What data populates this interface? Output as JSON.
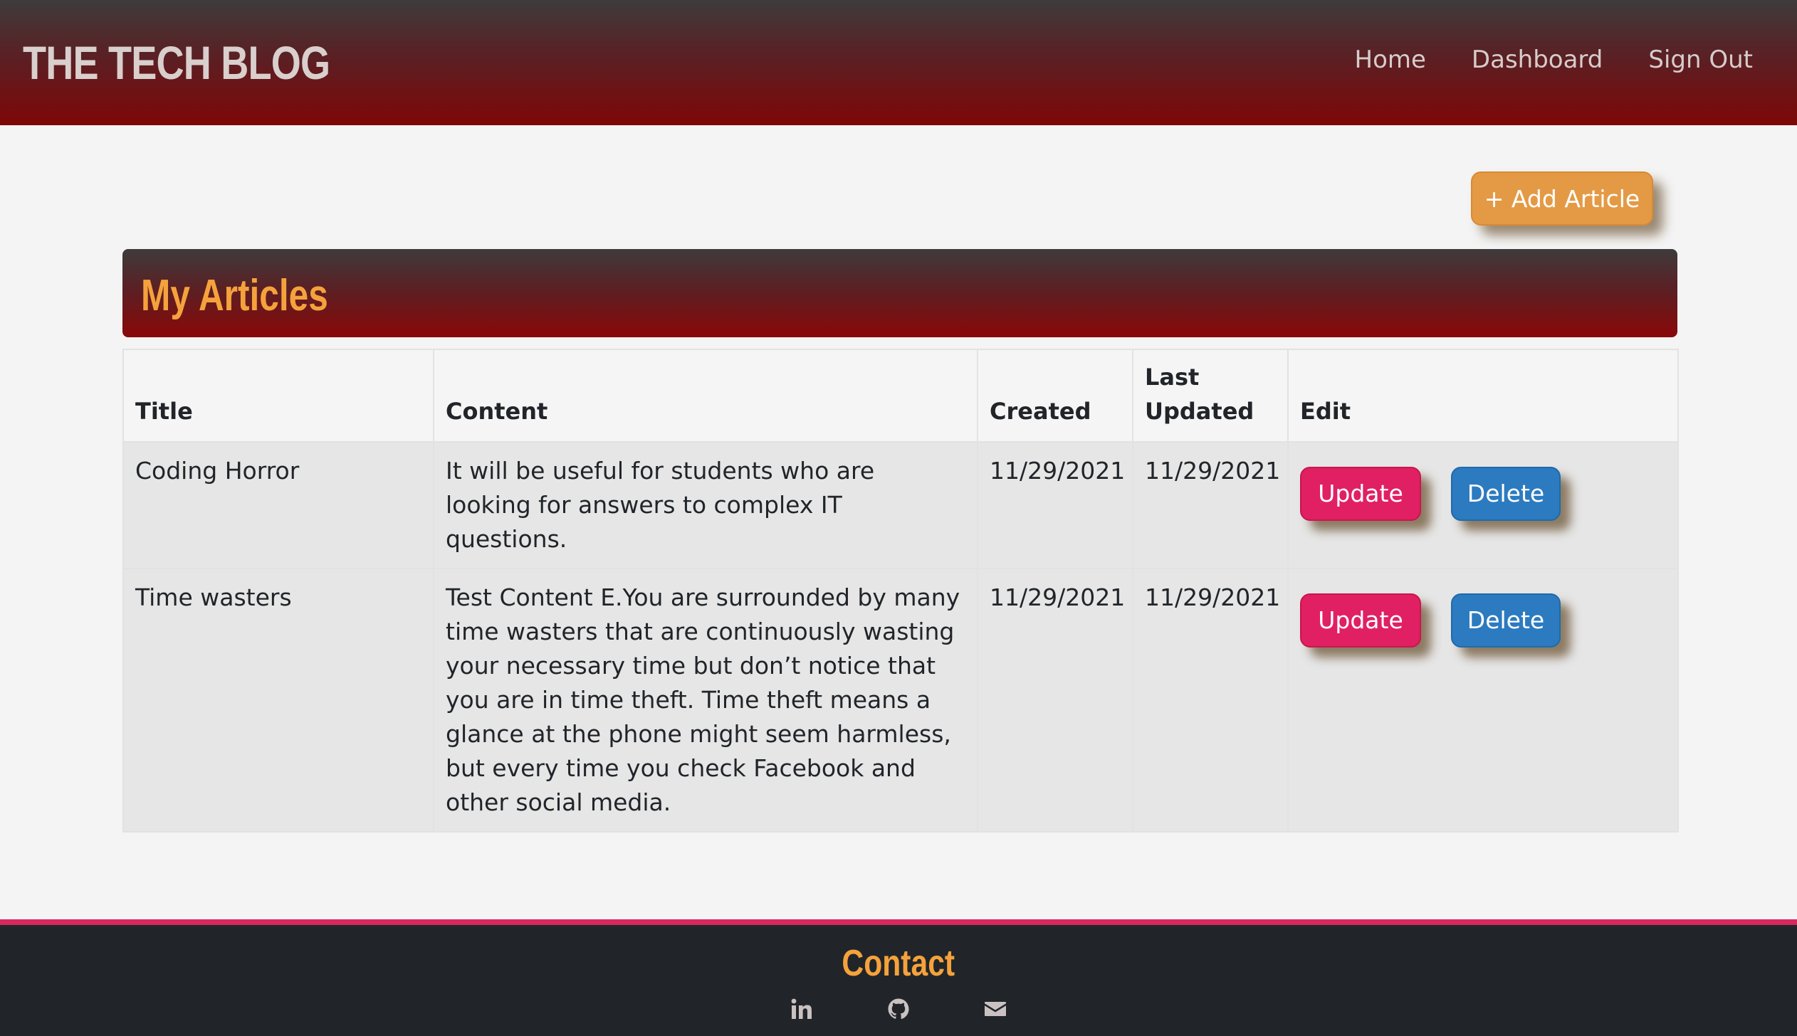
{
  "header": {
    "brand": "THE TECH BLOG",
    "nav": [
      "Home",
      "Dashboard",
      "Sign Out"
    ]
  },
  "add_article_label": "+ Add Article",
  "panel": {
    "title": "My Articles"
  },
  "table": {
    "headers": [
      "Title",
      "Content",
      "Created",
      "Last Updated",
      "Edit"
    ],
    "rows": [
      {
        "title": "Coding Horror",
        "content": "It will be useful for students who are looking for answers to complex IT questions.",
        "created": "11/29/2021",
        "updated": "11/29/2021"
      },
      {
        "title": "Time wasters",
        "content": "Test Content E.You are surrounded by many time wasters that are continuously wasting your necessary time but don’t notice that you are in time theft. Time theft means a glance at the phone might seem harmless, but every time you check Facebook and other social media.",
        "created": "11/29/2021",
        "updated": "11/29/2021"
      }
    ],
    "update_label": "Update",
    "delete_label": "Delete"
  },
  "footer": {
    "title": "Contact",
    "icons": [
      "linkedin-icon",
      "github-icon",
      "email-icon"
    ]
  },
  "colors": {
    "accent": "#f5a23c",
    "header_dark": "#7e0707",
    "update": "#e02062",
    "delete": "#2c7bc0",
    "add_article": "#e49a45",
    "footer_bg": "#212529",
    "footer_border": "#d8285f"
  }
}
